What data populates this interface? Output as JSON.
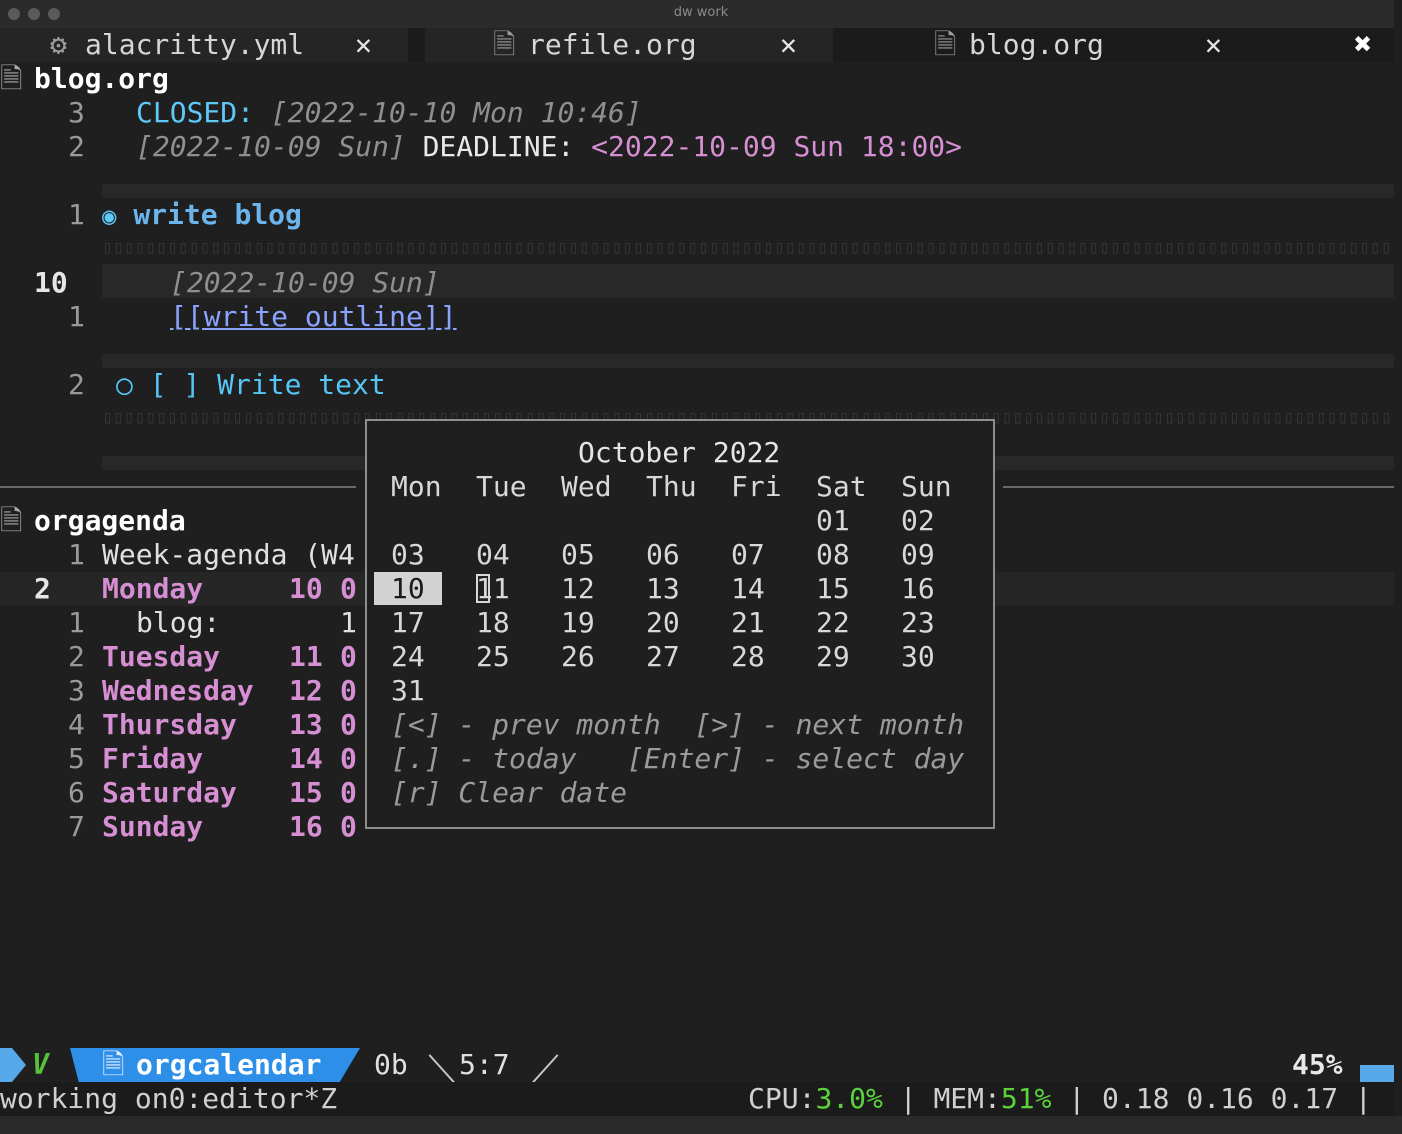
{
  "window": {
    "title": "dw work"
  },
  "tabs": [
    {
      "icon": "gear-icon",
      "icon_glyph": "⚙",
      "label": "alacritty.yml",
      "close": "✕"
    },
    {
      "icon": "file-icon",
      "icon_glyph": "🗎",
      "label": "refile.org",
      "close": "✕"
    },
    {
      "icon": "file-icon",
      "icon_glyph": "🗎",
      "label": "blog.org",
      "close": "✕"
    }
  ],
  "close_all": "✖",
  "blog": {
    "header": "blog.org",
    "header_icon": "🗎",
    "lines": {
      "l1_num": "3",
      "l1_kw": "CLOSED:",
      "l1_ts": " [2022-10-10 Mon 10:46]",
      "l2_num": "2",
      "l2_ts": "[2022-10-09 Sun]",
      "l2_kw": " DEADLINE: ",
      "l2_dl": "<2022-10-09 Sun 18:00>",
      "l3_num": "1",
      "l3_bullet": "◉",
      "l3_title": "write blog",
      "l4_num": "10",
      "l4_ts": "[2022-10-09 Sun]",
      "l5_num": "1",
      "l5_link": "[[write outline]]",
      "l6_num": "2",
      "l6_bullet": "○",
      "l6_text": "[ ] Write text"
    }
  },
  "agenda": {
    "header": "orgagenda",
    "header_icon": "🗎",
    "title_num": "1",
    "title": "Week-agenda (W4",
    "cur_num": "2",
    "sub_num": "1",
    "sub_label": "blog:",
    "sub_count": "1",
    "days": [
      {
        "num": "2",
        "name": "Monday",
        "date": "10",
        "count": "0"
      },
      {
        "num": "2",
        "name": "Tuesday",
        "date": "11",
        "count": "0"
      },
      {
        "num": "3",
        "name": "Wednesday",
        "date": "12",
        "count": "0"
      },
      {
        "num": "4",
        "name": "Thursday",
        "date": "13",
        "count": "0"
      },
      {
        "num": "5",
        "name": "Friday",
        "date": "14",
        "count": "0"
      },
      {
        "num": "6",
        "name": "Saturday",
        "date": "15",
        "count": "0"
      },
      {
        "num": "7",
        "name": "Sunday",
        "date": "16",
        "count": "0"
      }
    ]
  },
  "calendar": {
    "title": "October 2022",
    "weekdays": [
      "Mon",
      "Tue",
      "Wed",
      "Thu",
      "Fri",
      "Sat",
      "Sun"
    ],
    "weeks": [
      [
        "",
        "",
        "",
        "",
        "",
        "01",
        "02"
      ],
      [
        "03",
        "04",
        "05",
        "06",
        "07",
        "08",
        "09"
      ],
      [
        "10",
        "11",
        "12",
        "13",
        "14",
        "15",
        "16"
      ],
      [
        "17",
        "18",
        "19",
        "20",
        "21",
        "22",
        "23"
      ],
      [
        "24",
        "25",
        "26",
        "27",
        "28",
        "29",
        "30"
      ],
      [
        "31",
        "",
        "",
        "",
        "",
        "",
        ""
      ]
    ],
    "selected": "10",
    "cursor": "11",
    "help": [
      "[<] - prev month  [>] - next month",
      "[.] - today   [Enter] - select day",
      "[r] Clear date"
    ]
  },
  "statusline": {
    "mode": "V",
    "buffer_icon": "🗎",
    "buffer": "orgcalendar",
    "size": "0b",
    "position": "5:7",
    "percent": "45%"
  },
  "tmux": {
    "session": "working on0:editor*Z",
    "cpu_label": "CPU:",
    "cpu": "3.0%",
    "sep1": " | ",
    "mem_label": "MEM:",
    "mem": "51%",
    "sep2": " | ",
    "load": "0.18 0.16 0.17",
    "sep3": " |"
  },
  "colors": {
    "accent": "#2d8fe8",
    "keyword": "#5ec8f7",
    "deadline": "#d68fd2",
    "ok": "#5bd23b"
  }
}
